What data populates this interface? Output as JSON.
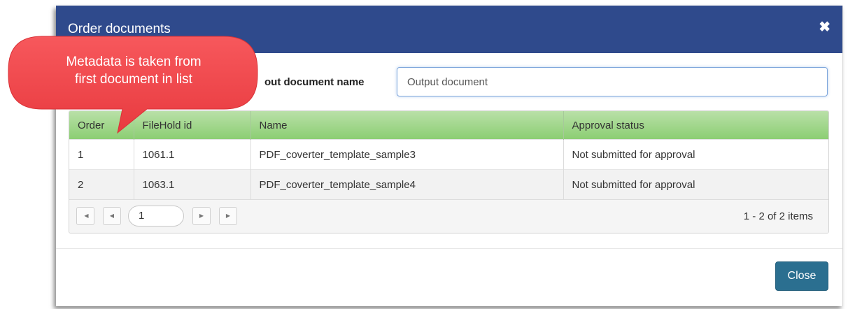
{
  "dialog": {
    "title": "Order documents",
    "close_icon": "✖"
  },
  "output": {
    "label": "Output document name",
    "label_visible": "out document name",
    "placeholder": "Output document"
  },
  "table": {
    "columns": [
      "Order",
      "FileHold id",
      "Name",
      "Approval status"
    ],
    "rows": [
      {
        "order": "1",
        "id": "1061.1",
        "name": "PDF_coverter_template_sample3",
        "status": "Not submitted for approval"
      },
      {
        "order": "2",
        "id": "1063.1",
        "name": "PDF_coverter_template_sample4",
        "status": "Not submitted for approval"
      }
    ]
  },
  "pager": {
    "first_icon": "◀",
    "prev_icon": "◀",
    "next_icon": "▶",
    "last_icon": "▶",
    "page": "1",
    "info": "1 - 2 of 2 items"
  },
  "footer": {
    "close_label": "Close"
  },
  "callout": {
    "line1": "Metadata is taken from",
    "line2": "first document in list"
  },
  "colors": {
    "header": "#2f4a8c",
    "grid_header": "#9fd68a",
    "close_button": "#2b6f90",
    "callout": "#f0474b"
  }
}
